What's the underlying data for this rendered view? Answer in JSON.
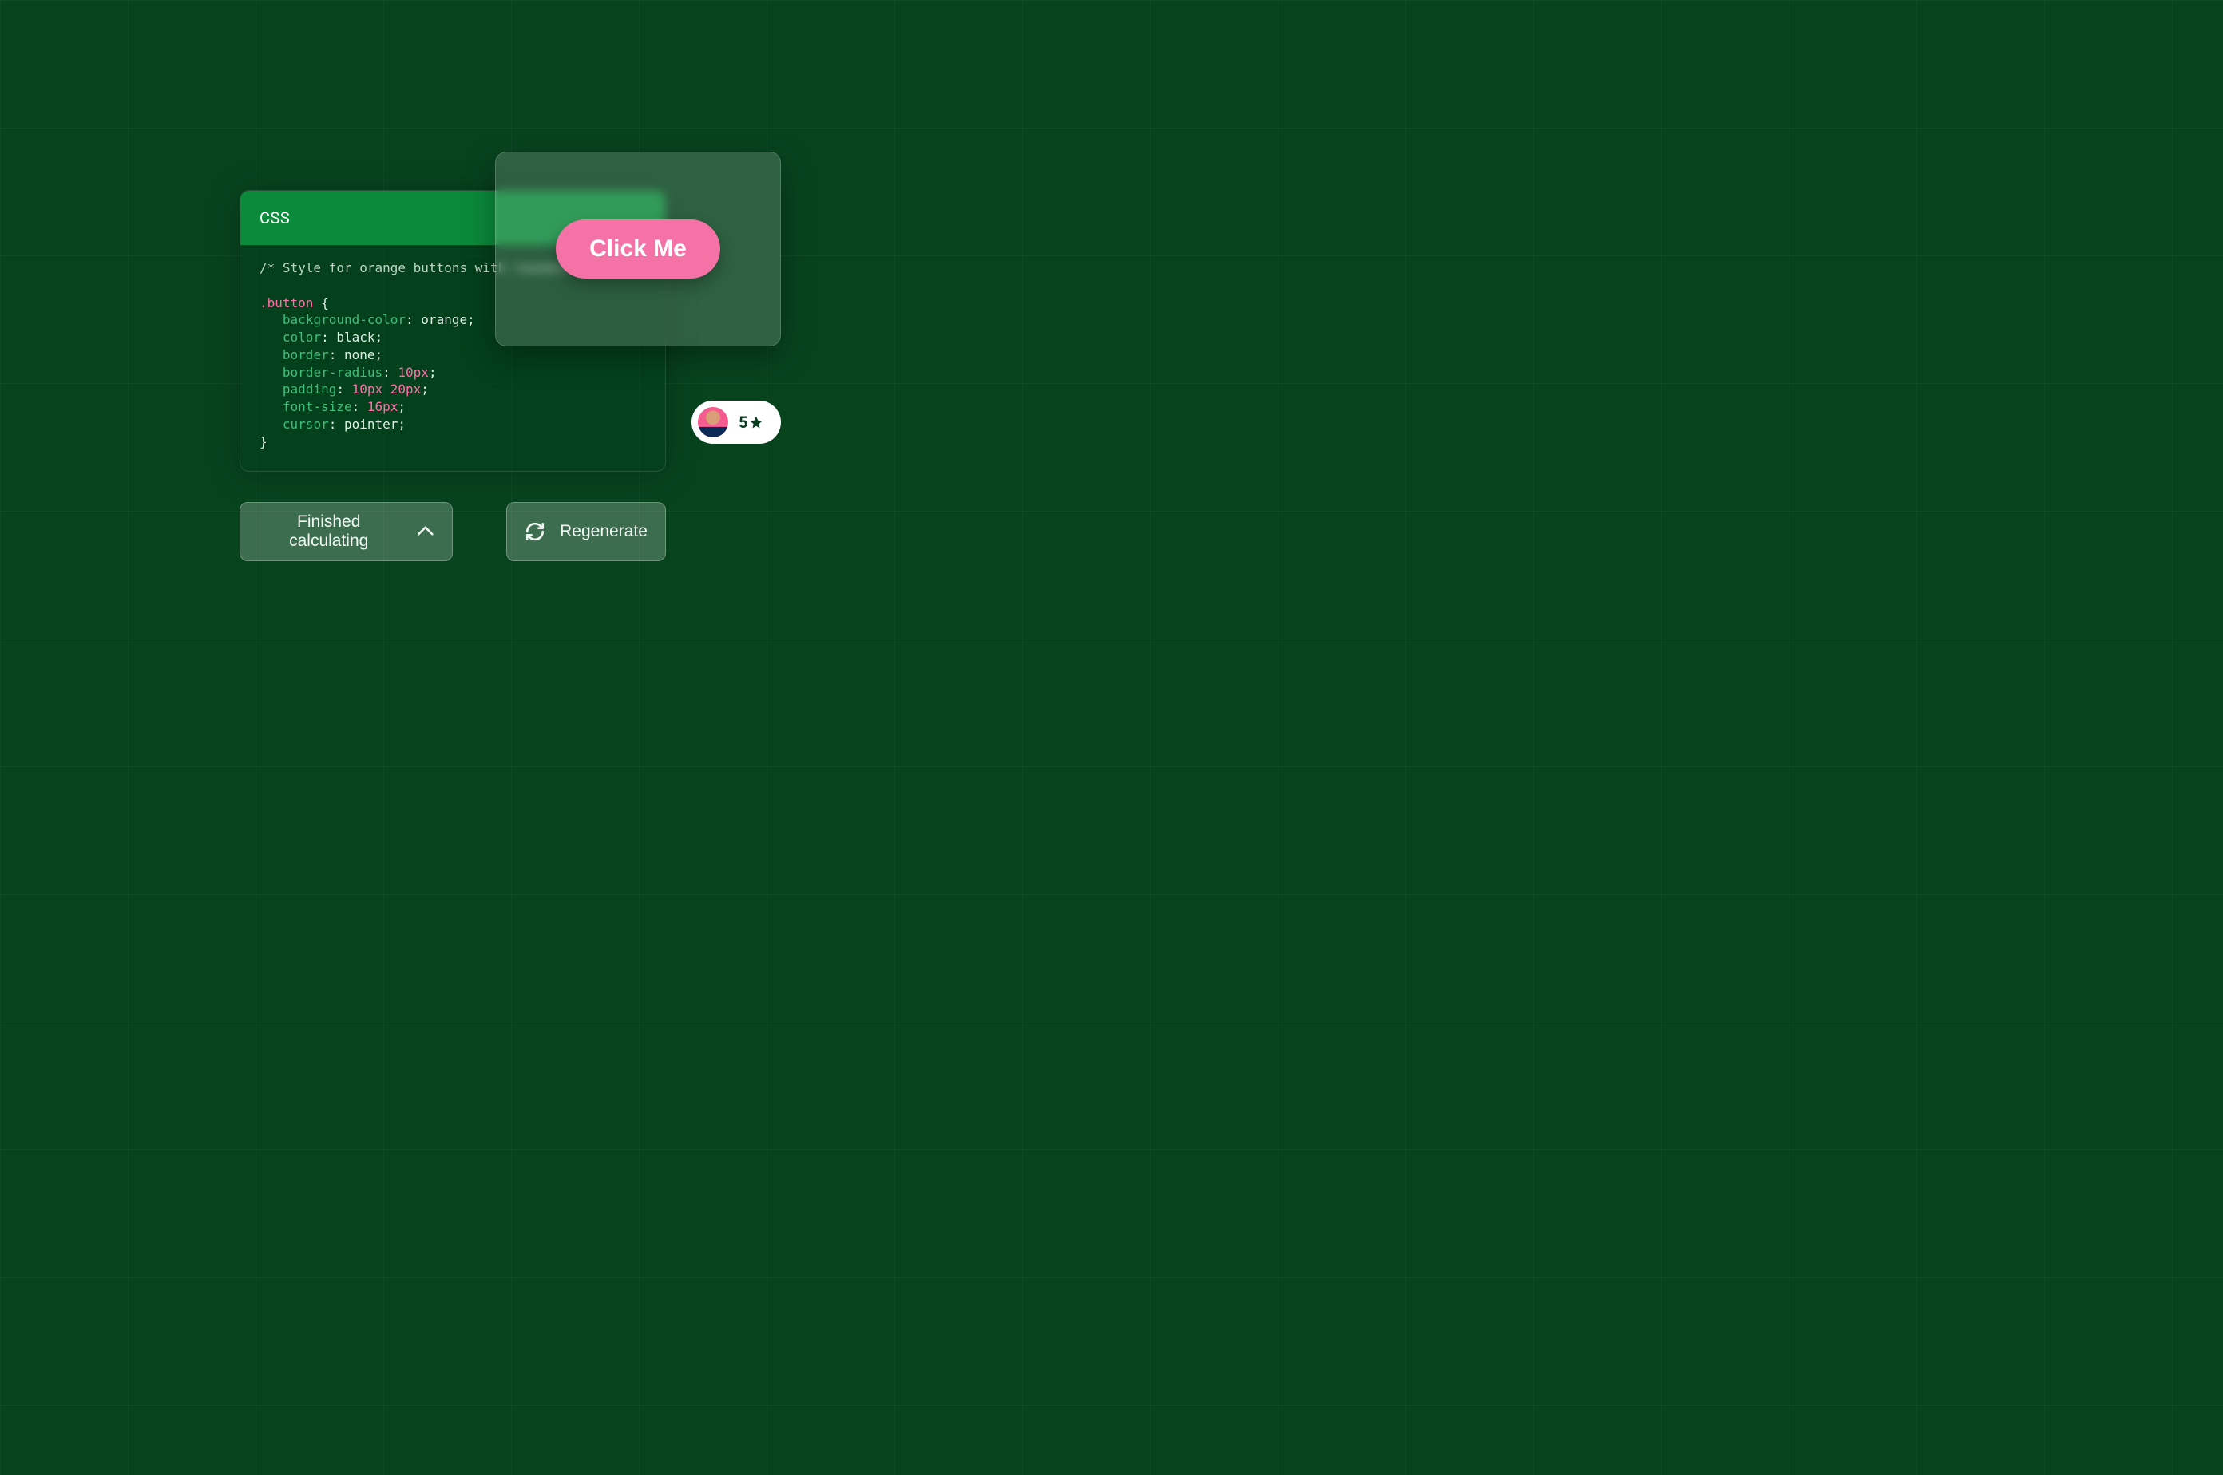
{
  "code_panel": {
    "header_label": "CSS",
    "comment": "/* Style for orange buttons with rounded",
    "selector": ".button",
    "open_brace": " {",
    "lines": [
      {
        "prop": "background-color",
        "value": "orange",
        "value_class": "tok-val"
      },
      {
        "prop": "color",
        "value": "black",
        "value_class": "tok-val"
      },
      {
        "prop": "border",
        "value": "none",
        "value_class": "tok-val"
      },
      {
        "prop": "border-radius",
        "value": "10px",
        "value_class": "tok-num"
      },
      {
        "prop": "padding",
        "value": "10px 20px",
        "value_class": "tok-num"
      },
      {
        "prop": "font-size",
        "value": "16px",
        "value_class": "tok-num"
      },
      {
        "prop": "cursor",
        "value": "pointer",
        "value_class": "tok-val"
      }
    ],
    "close_brace": "}"
  },
  "preview": {
    "button_label": "Click Me"
  },
  "rating": {
    "value": "5"
  },
  "actions": {
    "finished_label": "Finished calculating",
    "regenerate_label": "Regenerate"
  }
}
